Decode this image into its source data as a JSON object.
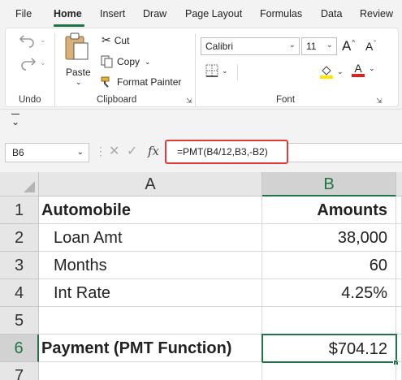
{
  "menu": {
    "tabs": [
      "File",
      "Home",
      "Insert",
      "Draw",
      "Page Layout",
      "Formulas",
      "Data",
      "Review"
    ],
    "active_tab": "Home"
  },
  "ribbon": {
    "undo_group": "Undo",
    "clipboard": {
      "paste": "Paste",
      "cut": "Cut",
      "copy": "Copy",
      "format_painter": "Format Painter",
      "label": "Clipboard"
    },
    "font": {
      "family": "Calibri",
      "size": "11",
      "label": "Font",
      "grow_font": "A",
      "shrink_font": "A",
      "font_color_letter": "A",
      "highlight_color": "#ffe600",
      "font_color": "#e02020"
    }
  },
  "formula_bar": {
    "name_box": "B6",
    "fx_label": "fx",
    "formula": "=PMT(B4/12,B3,-B2)"
  },
  "sheet": {
    "columns": [
      "A",
      "B"
    ],
    "rows": [
      {
        "num": "1",
        "a": "Automobile",
        "b": "Amounts"
      },
      {
        "num": "2",
        "a": "Loan Amt",
        "b": "38,000"
      },
      {
        "num": "3",
        "a": "Months",
        "b": "60"
      },
      {
        "num": "4",
        "a": "Int Rate",
        "b": "4.25%"
      },
      {
        "num": "5",
        "a": "",
        "b": ""
      },
      {
        "num": "6",
        "a": "Payment (PMT Function)",
        "b": "$704.12"
      },
      {
        "num": "7",
        "a": "",
        "b": ""
      }
    ],
    "selected_cell": "B6",
    "accent_color": "#217346"
  }
}
